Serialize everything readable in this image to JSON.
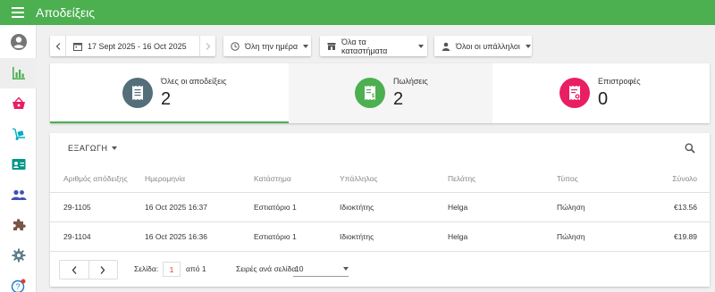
{
  "app": {
    "title": "Αποδείξεις",
    "menu_icon": "menu-icon"
  },
  "sidebar": {
    "items": [
      {
        "name": "account",
        "icon": "account-circle-icon",
        "color": "#757575"
      },
      {
        "name": "reports",
        "icon": "bar-chart-icon",
        "color": "#4caf50",
        "active": true
      },
      {
        "name": "sales",
        "icon": "basket-icon",
        "color": "#e91e63"
      },
      {
        "name": "inventory",
        "icon": "dolly-icon",
        "color": "#00acc1"
      },
      {
        "name": "customers",
        "icon": "contact-card-icon",
        "color": "#009688"
      },
      {
        "name": "employees",
        "icon": "people-icon",
        "color": "#3f51b5"
      },
      {
        "name": "integrations",
        "icon": "puzzle-icon",
        "color": "#795548"
      },
      {
        "name": "settings",
        "icon": "gear-icon",
        "color": "#607d8b"
      },
      {
        "name": "help",
        "icon": "help-icon",
        "color": "#1976d2"
      }
    ]
  },
  "filters": {
    "date_range": "17 Sept 2025 - 16 Oct 2025",
    "time": "Όλη την ημέρα",
    "stores": "Όλα τα καταστήματα",
    "employees": "Όλοι οι υπάλληλοι"
  },
  "summary": {
    "all": {
      "label": "Όλες οι αποδείξεις",
      "value": "2",
      "color": "#546e7a"
    },
    "sales": {
      "label": "Πωλήσεις",
      "value": "2",
      "color": "#4caf50"
    },
    "refunds": {
      "label": "Επιστροφές",
      "value": "0",
      "color": "#e91e63"
    }
  },
  "table": {
    "export_label": "ΕΞΑΓΩΓΗ",
    "columns": [
      "Αριθμός απόδειξης",
      "Ημερομηνία",
      "Κατάστημα",
      "Υπάλληλος",
      "Πελάτης",
      "Τύπος",
      "Σύνολο"
    ],
    "rows": [
      [
        "29-1105",
        "16 Oct 2025 16:37",
        "Εστιατόριο 1",
        "Ιδιοκτήτης",
        "Helga",
        "Πώληση",
        "€13.56"
      ],
      [
        "29-1104",
        "16 Oct 2025 16:36",
        "Εστιατόριο 1",
        "Ιδιοκτήτης",
        "Helga",
        "Πώληση",
        "€19.89"
      ]
    ]
  },
  "pagination": {
    "page_label": "Σελίδα:",
    "page_value": "1",
    "of_label": "από 1",
    "rows_label": "Σειρές ανά σελίδα:",
    "rows_value": "10"
  }
}
